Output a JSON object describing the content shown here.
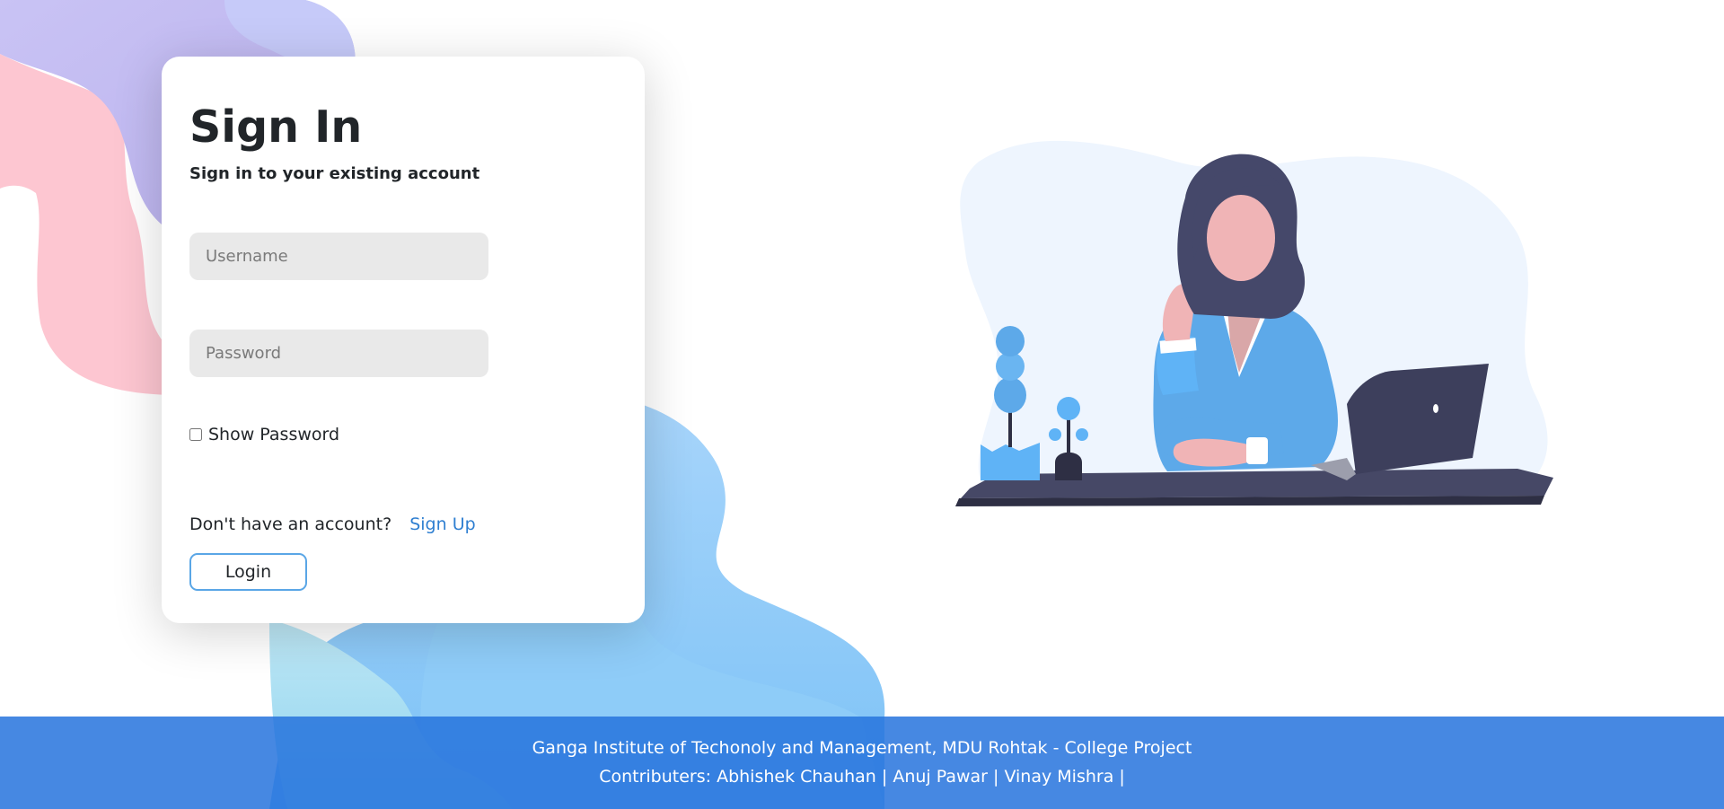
{
  "signin": {
    "title": "Sign In",
    "subtitle": "Sign in to your existing account",
    "username_placeholder": "Username",
    "password_placeholder": "Password",
    "show_password_label": "Show Password",
    "show_password_checked": false,
    "no_account_text": "Don't have an account?",
    "signup_link": "Sign Up",
    "login_button": "Login"
  },
  "footer": {
    "line1": "Ganga Institute of Techonoly and Management, MDU Rohtak - College Project",
    "line2": "Contributers: Abhishek Chauhan | Anuj Pawar | Vinay Mishra |"
  },
  "illustration": {
    "icon": "woman-with-laptop-illustration"
  },
  "colors": {
    "accent": "#2f7fd1",
    "footer": "#2673dd",
    "button_border": "#5aa6e6",
    "input_bg": "#e9e9e9"
  }
}
